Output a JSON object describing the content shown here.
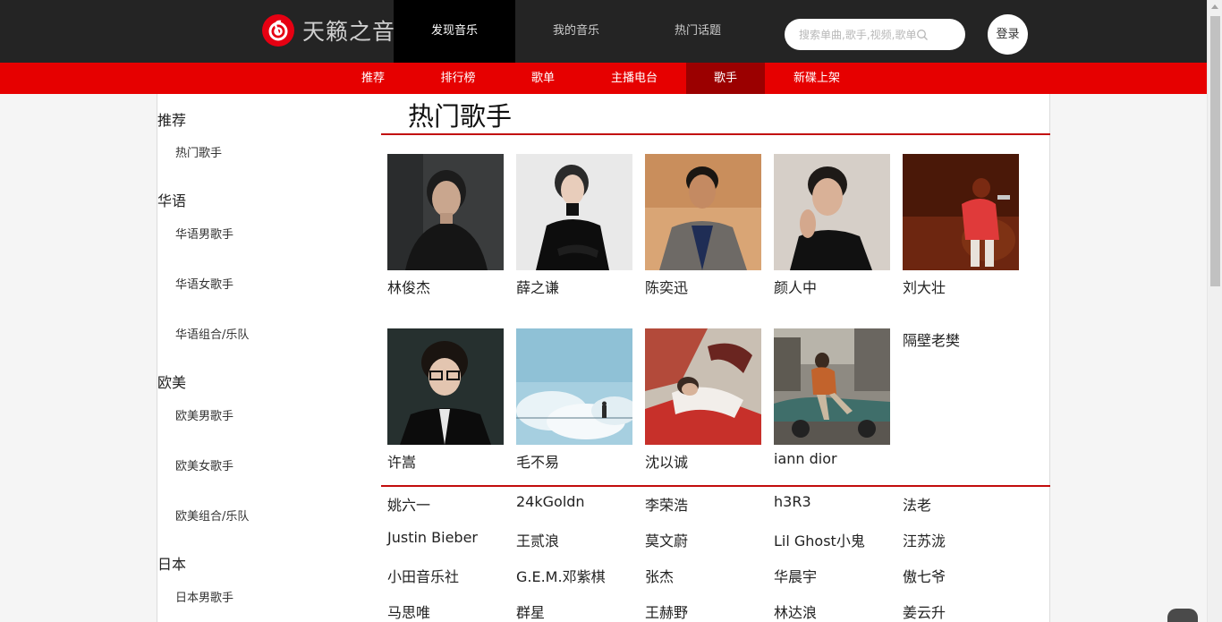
{
  "header": {
    "logo_text": "天籁之音",
    "nav": [
      {
        "label": "发现音乐",
        "active": true
      },
      {
        "label": "我的音乐",
        "active": false
      },
      {
        "label": "热门话题",
        "active": false
      }
    ],
    "search_placeholder": "搜索单曲,歌手,视频,歌单",
    "login_label": "登录"
  },
  "subnav": [
    {
      "label": "推荐",
      "active": false
    },
    {
      "label": "排行榜",
      "active": false
    },
    {
      "label": "歌单",
      "active": false
    },
    {
      "label": "主播电台",
      "active": false
    },
    {
      "label": "歌手",
      "active": true
    },
    {
      "label": "新碟上架",
      "active": false
    }
  ],
  "sidebar": [
    {
      "label": "推荐",
      "items": [
        "热门歌手"
      ]
    },
    {
      "label": "华语",
      "items": [
        "华语男歌手",
        "华语女歌手",
        "华语组合/乐队"
      ]
    },
    {
      "label": "欧美",
      "items": [
        "欧美男歌手",
        "欧美女歌手",
        "欧美组合/乐队"
      ]
    },
    {
      "label": "日本",
      "items": [
        "日本男歌手"
      ]
    }
  ],
  "main": {
    "title": "热门歌手",
    "featured": [
      {
        "name": "林俊杰",
        "photo": "portrait-dark"
      },
      {
        "name": "薛之谦",
        "photo": "portrait-black-suit"
      },
      {
        "name": "陈奕迅",
        "photo": "portrait-warm"
      },
      {
        "name": "颜人中",
        "photo": "portrait-young"
      },
      {
        "name": "刘大壮",
        "photo": "stage-red-hoodie"
      },
      {
        "name": "许嵩",
        "photo": "portrait-glasses"
      },
      {
        "name": "毛不易",
        "photo": "album-sky"
      },
      {
        "name": "沈以诚",
        "photo": "album-red-white"
      },
      {
        "name": "iann dior",
        "photo": "car-street"
      },
      {
        "name": "隔壁老樊",
        "photo": null
      }
    ],
    "artists": [
      "姚六一",
      "24kGoldn",
      "李荣浩",
      "h3R3",
      "法老",
      "Justin Bieber",
      "王贰浪",
      "莫文蔚",
      "Lil Ghost小鬼",
      "汪苏泷",
      "小田音乐社",
      "G.E.M.邓紫棋",
      "张杰",
      "华晨宇",
      "傲七爷",
      "马思唯",
      "群星",
      "王赫野",
      "林达浪",
      "姜云升"
    ]
  },
  "colors": {
    "header_bg": "#242424",
    "accent_red": "#e60000",
    "active_sub": "#9b0000",
    "divider_red": "#c20c0c"
  }
}
